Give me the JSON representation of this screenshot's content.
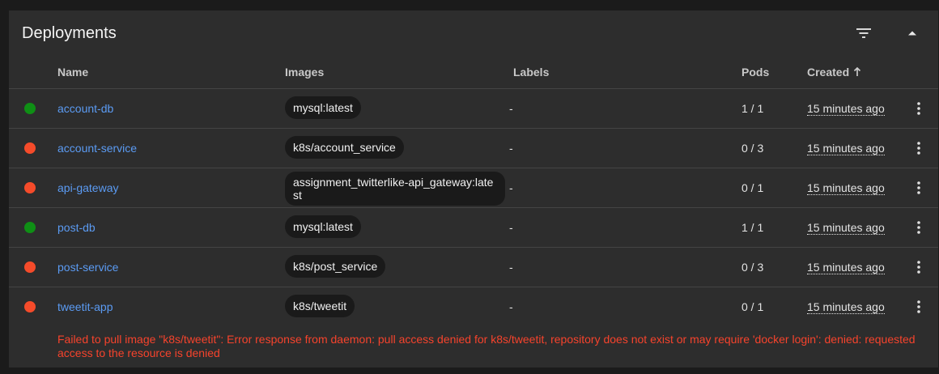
{
  "card": {
    "title": "Deployments"
  },
  "columns": {
    "name": "Name",
    "images": "Images",
    "labels": "Labels",
    "pods": "Pods",
    "created": "Created"
  },
  "colors": {
    "ok": "#0f8f15",
    "error": "#f54b2a",
    "link": "#5b9bf3"
  },
  "rows": [
    {
      "status": "ok",
      "name": "account-db",
      "image": "mysql:latest",
      "labels": "-",
      "pods": "1 / 1",
      "created": "15 minutes ago"
    },
    {
      "status": "error",
      "name": "account-service",
      "image": "k8s/account_service",
      "labels": "-",
      "pods": "0 / 3",
      "created": "15 minutes ago"
    },
    {
      "status": "error",
      "name": "api-gateway",
      "image": "assignment_twitterlike-api_gateway:latest",
      "labels": "-",
      "pods": "0 / 1",
      "created": "15 minutes ago"
    },
    {
      "status": "ok",
      "name": "post-db",
      "image": "mysql:latest",
      "labels": "-",
      "pods": "1 / 1",
      "created": "15 minutes ago"
    },
    {
      "status": "error",
      "name": "post-service",
      "image": "k8s/post_service",
      "labels": "-",
      "pods": "0 / 3",
      "created": "15 minutes ago"
    },
    {
      "status": "error",
      "name": "tweetit-app",
      "image": "k8s/tweetit",
      "labels": "-",
      "pods": "0 / 1",
      "created": "15 minutes ago"
    }
  ],
  "error_message": "Failed to pull image \"k8s/tweetit\": Error response from daemon: pull access denied for k8s/tweetit, repository does not exist or may require 'docker login': denied: requested access to the resource is denied"
}
